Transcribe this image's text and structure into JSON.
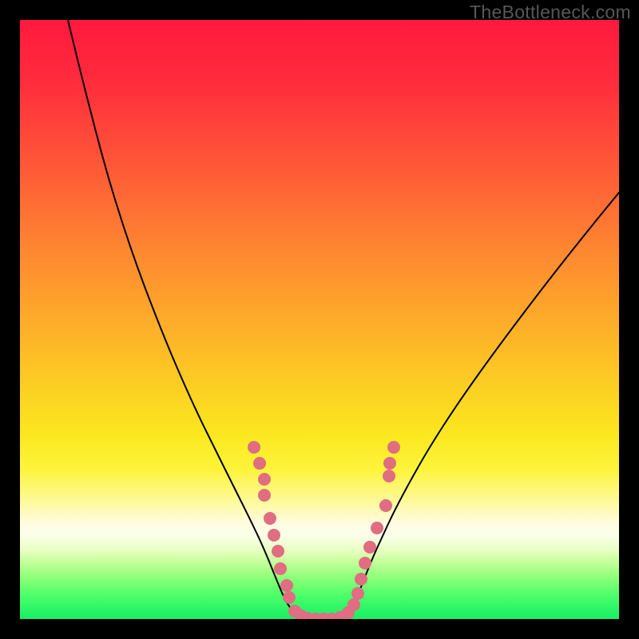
{
  "watermark": "TheBottleneck.com",
  "domain_info": {
    "xrange": [
      0,
      750
    ],
    "yrange_pixels": [
      0,
      750
    ]
  },
  "chart_data": {
    "type": "line",
    "title": "",
    "xlabel": "",
    "ylabel": "",
    "x_domain": [
      0,
      750
    ],
    "y_domain_pixels_note": "y values are pixel coords from top inside 750x750 plot; larger = closer to bottom (better/green).",
    "series": [
      {
        "name": "bottleneck-curve",
        "points": [
          [
            60,
            0
          ],
          [
            95,
            145
          ],
          [
            135,
            278
          ],
          [
            178,
            392
          ],
          [
            216,
            480
          ],
          [
            248,
            545
          ],
          [
            270,
            589
          ],
          [
            286,
            621
          ],
          [
            300,
            650
          ],
          [
            310,
            673
          ],
          [
            318,
            693
          ],
          [
            325,
            710
          ],
          [
            331,
            724
          ],
          [
            338,
            736
          ],
          [
            346,
            744
          ],
          [
            356,
            748
          ],
          [
            368,
            749
          ],
          [
            382,
            749
          ],
          [
            396,
            748
          ],
          [
            406,
            744
          ],
          [
            414,
            736
          ],
          [
            421,
            724
          ],
          [
            427,
            710
          ],
          [
            434,
            692
          ],
          [
            443,
            670
          ],
          [
            454,
            646
          ],
          [
            468,
            616
          ],
          [
            487,
            580
          ],
          [
            512,
            536
          ],
          [
            548,
            480
          ],
          [
            598,
            410
          ],
          [
            660,
            328
          ],
          [
            714,
            260
          ],
          [
            750,
            216
          ]
        ]
      }
    ],
    "dots": {
      "name": "highlight-dots",
      "points": [
        [
          293,
          535
        ],
        [
          300,
          555
        ],
        [
          306,
          575
        ],
        [
          306,
          595
        ],
        [
          313,
          624
        ],
        [
          318,
          645
        ],
        [
          323,
          665
        ],
        [
          326,
          687
        ],
        [
          334,
          708
        ],
        [
          337,
          723
        ],
        [
          344,
          740
        ],
        [
          352,
          746
        ],
        [
          360,
          749
        ],
        [
          370,
          750
        ],
        [
          380,
          750
        ],
        [
          390,
          750
        ],
        [
          401,
          748
        ],
        [
          411,
          742
        ],
        [
          418,
          732
        ],
        [
          423,
          718
        ],
        [
          427,
          700
        ],
        [
          432,
          680
        ],
        [
          438,
          660
        ],
        [
          447,
          636
        ],
        [
          458,
          608
        ],
        [
          462,
          571
        ],
        [
          463,
          555
        ],
        [
          468,
          535
        ]
      ]
    },
    "colors": {
      "curve": "#000000",
      "dots": "#e06d81",
      "bg_top": "#ff193f",
      "bg_mid": "#fce71f",
      "bg_bottom": "#17ee65",
      "frame": "#000000"
    }
  }
}
